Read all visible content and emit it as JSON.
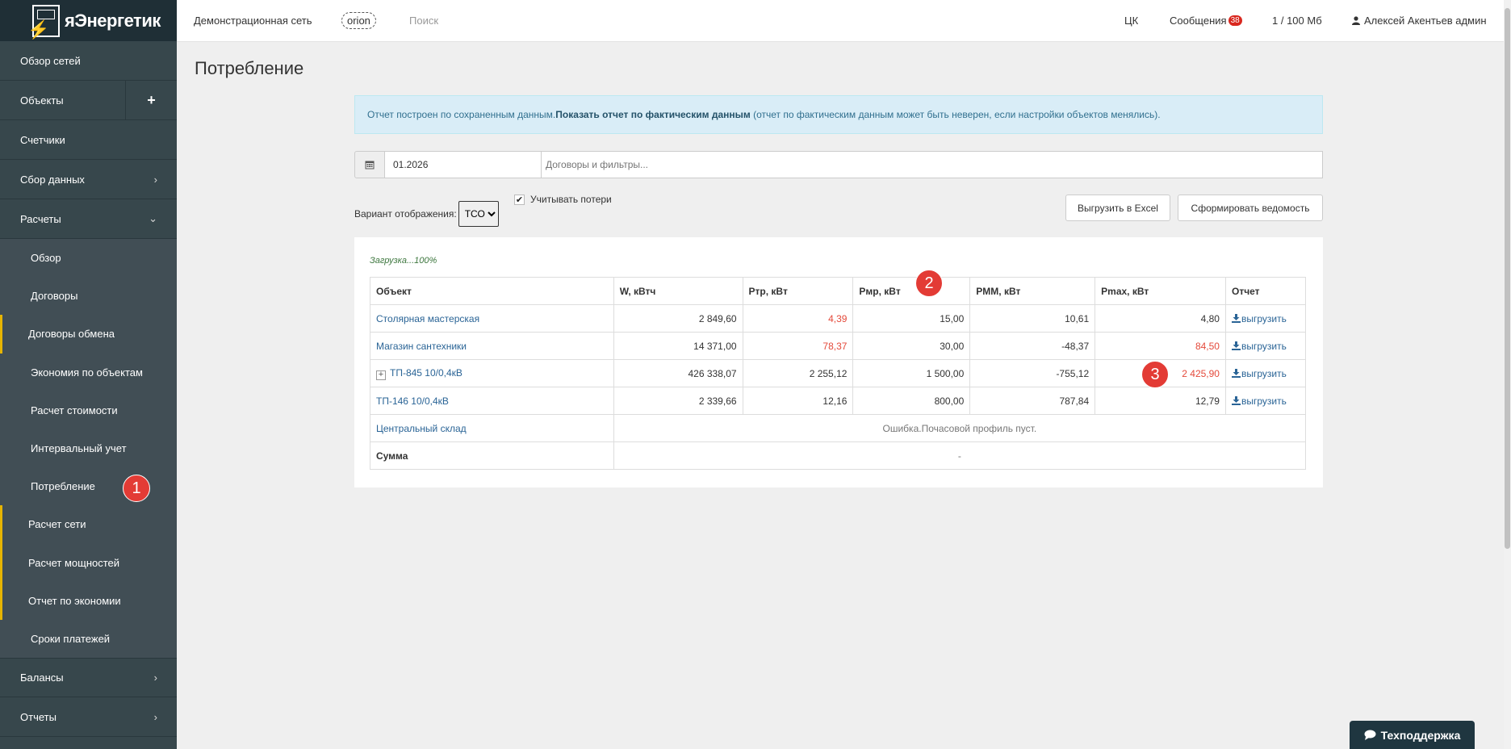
{
  "app": {
    "logo_text": "яЭнергетик"
  },
  "sidebar": {
    "items": [
      {
        "label": "Обзор сетей"
      },
      {
        "label": "Объекты"
      },
      {
        "label": "Счетчики"
      },
      {
        "label": "Сбор данных"
      },
      {
        "label": "Расчеты"
      }
    ],
    "sub_items": [
      {
        "label": "Обзор"
      },
      {
        "label": "Договоры"
      },
      {
        "label": "Договоры обмена"
      },
      {
        "label": "Экономия по объектам"
      },
      {
        "label": "Расчет стоимости"
      },
      {
        "label": "Интервальный учет"
      },
      {
        "label": "Потребление"
      },
      {
        "label": "Расчет сети"
      },
      {
        "label": "Расчет мощностей"
      },
      {
        "label": "Отчет по экономии"
      },
      {
        "label": "Сроки платежей"
      }
    ],
    "bottom_items": [
      {
        "label": "Балансы"
      },
      {
        "label": "Отчеты"
      }
    ]
  },
  "topbar": {
    "network": "Демонстрационная сеть",
    "tag": "orion",
    "search": "Поиск",
    "ck": "ЦК",
    "messages": "Сообщения",
    "messages_count": "38",
    "quota": "1 / 100 Мб",
    "user": "Алексей Акентьев админ"
  },
  "page": {
    "title": "Потребление",
    "alert_prefix": "Отчет построен по сохраненным данным.",
    "alert_link": "Показать отчет по фактическим данным",
    "alert_suffix": " (отчет по фактическим данным может быть неверен, если настройки объектов менялись).",
    "date": "01.2026",
    "filter_placeholder": "Договоры и фильтры...",
    "variant_label": "Вариант отображения:",
    "variant_value": "ТСО",
    "losses_label": "Учитывать потери",
    "export_excel": "Выгрузить в Excel",
    "make_sheet": "Сформировать ведомость",
    "loading": "Загрузка...100%"
  },
  "table": {
    "headers": [
      "Объект",
      "W, кВтч",
      "Pтр, кВт",
      "Pмр, кВт",
      "PММ, кВт",
      "Pmax, кВт",
      "Отчет"
    ],
    "rows": [
      {
        "object": "Столярная мастерская",
        "w": "2 849,60",
        "ptr": "4,39",
        "pmr": "15,00",
        "pmm": "10,61",
        "pmax": "4,80",
        "report": "выгрузить"
      },
      {
        "object": "Магазин сантехники",
        "w": "14 371,00",
        "ptr": "78,37",
        "pmr": "30,00",
        "pmm": "-48,37",
        "pmax": "84,50",
        "report": "выгрузить"
      },
      {
        "object": "ТП-845 10/0,4кВ",
        "w": "426 338,07",
        "ptr": "2 255,12",
        "pmr": "1 500,00",
        "pmm": "-755,12",
        "pmax": "2 425,90",
        "report": "выгрузить"
      },
      {
        "object": "ТП-146 10/0,4кВ",
        "w": "2 339,66",
        "ptr": "12,16",
        "pmr": "800,00",
        "pmm": "787,84",
        "pmax": "12,79",
        "report": "выгрузить"
      }
    ],
    "error_row": {
      "object": "Центральный склад",
      "message": "Ошибка.Почасовой профиль пуст."
    },
    "sum_row": {
      "label": "Сумма",
      "value": "-"
    }
  },
  "markers": [
    "1",
    "2",
    "3"
  ],
  "support": {
    "label": "Техподдержка"
  },
  "colors": {
    "sidebar": "#37474c",
    "accent": "#e6b400",
    "red": "#e44a3b",
    "link": "#2a6496"
  }
}
